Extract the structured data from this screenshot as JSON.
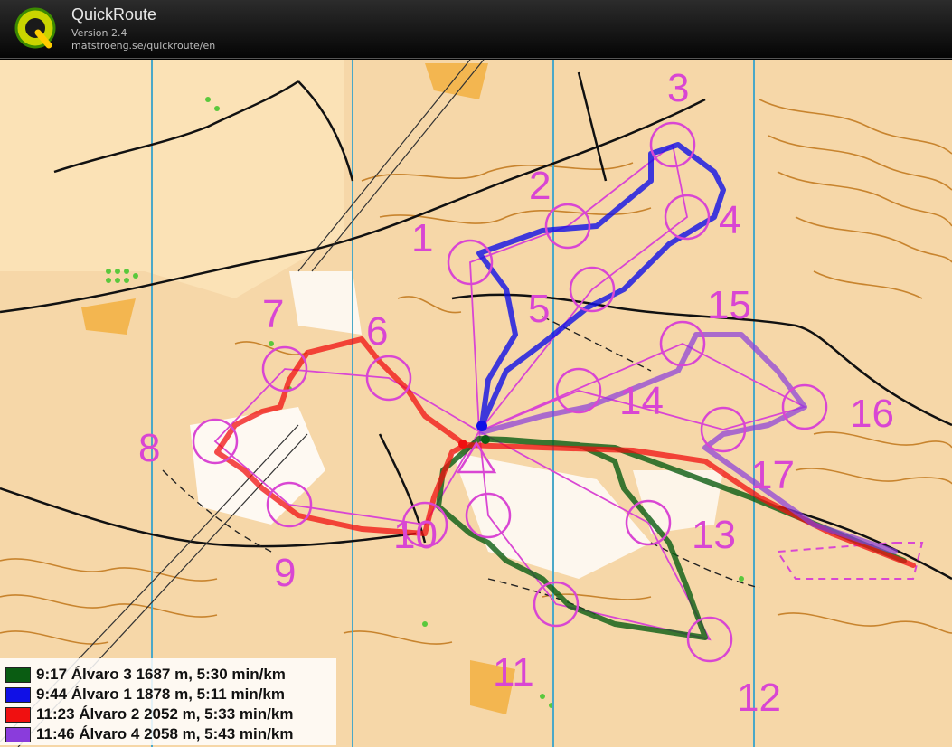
{
  "app": {
    "title": "QuickRoute",
    "version": "Version 2.4",
    "url": "matstroeng.se/quickroute/en"
  },
  "colors": {
    "course": "#d946d3",
    "map_background": "#f6d7a8",
    "contour": "#c8842e"
  },
  "control_numbers": [
    "1",
    "2",
    "3",
    "4",
    "5",
    "6",
    "7",
    "8",
    "9",
    "10",
    "11",
    "12",
    "13",
    "14",
    "15",
    "16",
    "17"
  ],
  "legend": [
    {
      "label": "9:17 Álvaro 3 1687 m, 5:30 min/km",
      "color": "#0a5c12"
    },
    {
      "label": "9:44 Álvaro 1 1878 m, 5:11 min/km",
      "color": "#1010e6"
    },
    {
      "label": "11:23 Álvaro 2 2052 m, 5:33 min/km",
      "color": "#f01010"
    },
    {
      "label": "11:46 Álvaro 4 2058 m, 5:43 min/km",
      "color": "#8a3cdc"
    }
  ]
}
